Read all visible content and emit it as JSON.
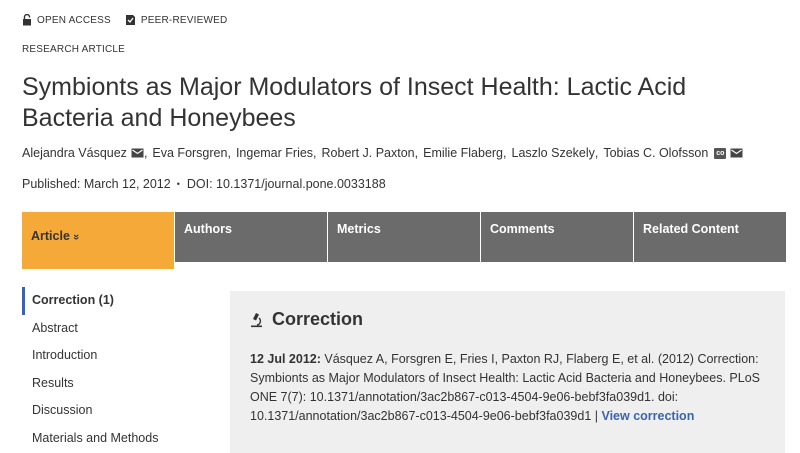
{
  "badges": {
    "open_access": "OPEN ACCESS",
    "peer_reviewed": "PEER-REVIEWED"
  },
  "article_type": "RESEARCH ARTICLE",
  "title": "Symbionts as Major Modulators of Insect Health: Lactic Acid Bacteria and Honeybees",
  "authors": [
    {
      "name": "Alejandra Vásquez",
      "email_icon": true
    },
    {
      "name": "Eva Forsgren"
    },
    {
      "name": "Ingemar Fries"
    },
    {
      "name": "Robert J. Paxton"
    },
    {
      "name": "Emilie Flaberg"
    },
    {
      "name": "Laszlo Szekely"
    },
    {
      "name": "Tobias C. Olofsson",
      "co_badge": "co",
      "email_icon": true
    }
  ],
  "published": "Published: March 12, 2012",
  "bullet": "•",
  "doi": "DOI: 10.1371/journal.pone.0033188",
  "tabs": [
    {
      "label": "Article",
      "active": true,
      "chevron": "»"
    },
    {
      "label": "Authors"
    },
    {
      "label": "Metrics"
    },
    {
      "label": "Comments"
    },
    {
      "label": "Related Content"
    }
  ],
  "sidenav": [
    "Correction (1)",
    "Abstract",
    "Introduction",
    "Results",
    "Discussion",
    "Materials and Methods"
  ],
  "correction": {
    "heading": "Correction",
    "date": "12 Jul 2012:",
    "text": " Vásquez A, Forsgren E, Fries I, Paxton RJ, Flaberg E, et al. (2012) Correction: Symbionts as Major Modulators of Insect Health: Lactic Acid Bacteria and Honeybees. PLoS ONE 7(7): 10.1371/annotation/3ac2b867-c013-4504-9e06-bebf3fa039d1. doi: 10.1371/annotation/3ac2b867-c013-4504-9e06-bebf3fa039d1 | ",
    "link": "View correction"
  },
  "colors": {
    "active_tab": "#f5a938",
    "tab": "#6b6b6b",
    "link": "#3c63af",
    "correction_bg": "#efefef"
  },
  "icons": {
    "open_access": "lock-open-icon",
    "peer_reviewed": "peer-reviewed-icon",
    "email": "envelope-icon",
    "correction": "microscope-icon"
  }
}
